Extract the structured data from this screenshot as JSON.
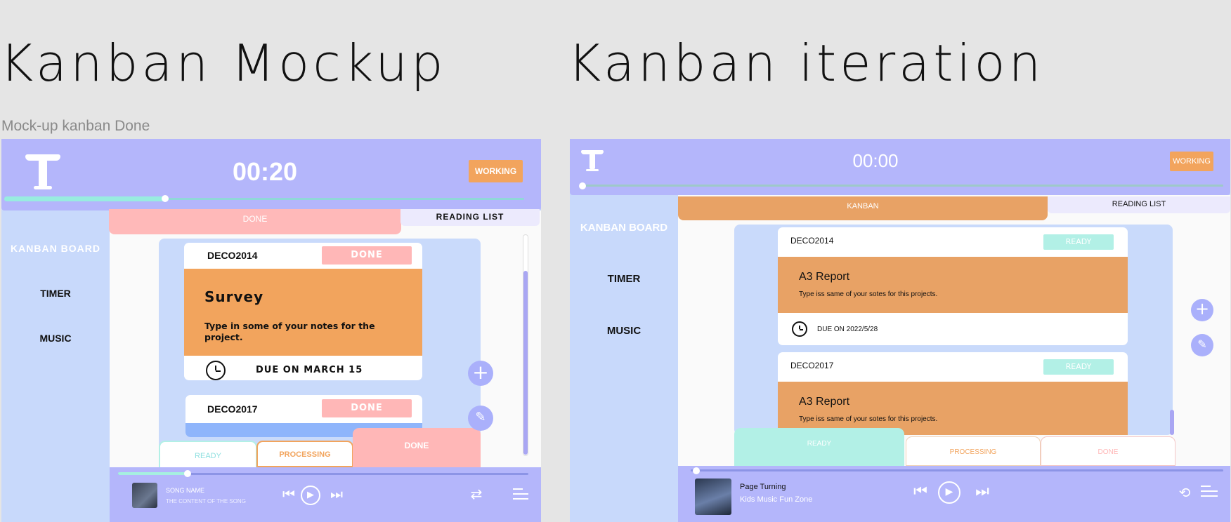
{
  "headings": {
    "left": "Kanban Mockup",
    "right": "Kanban iteration",
    "caption": "Mock-up kanban Done"
  },
  "mockup": {
    "timer": "00:20",
    "status": "WORKING",
    "timer_progress": 0.31,
    "nav": {
      "kanban": "KANBAN BOARD",
      "timer": "TIMER",
      "music": "MUSIC"
    },
    "tabs": {
      "active": "DONE",
      "other": "READING LIST"
    },
    "cards": [
      {
        "code": "DECO2014",
        "badge": "DONE",
        "title": "Survey",
        "note": "Type in some of your notes for the project.",
        "due": "DUE ON MARCH 15"
      },
      {
        "code": "DECO2017",
        "badge": "DONE"
      }
    ],
    "columns": {
      "ready": "READY",
      "processing": "PROCESSING",
      "done": "DONE"
    },
    "player": {
      "song": "SONG NAME",
      "artist": "THE CONTENT OF THE SONG",
      "progress": 0.17
    }
  },
  "iteration": {
    "timer": "00:00",
    "status": "WORKING",
    "timer_progress": 0.0,
    "nav": {
      "kanban": "KANBAN BOARD",
      "timer": "TIMER",
      "music": "MUSIC"
    },
    "tabs": {
      "active": "KANBAN",
      "other": "READING LIST"
    },
    "cards": [
      {
        "code": "DECO2014",
        "badge": "READY",
        "title": "A3 Report",
        "note": "Type iss same of your sotes for this projects.",
        "due": "DUE ON 2022/5/28"
      },
      {
        "code": "DECO2017",
        "badge": "READY",
        "title": "A3 Report",
        "note": "Type iss same of your sotes for this projects."
      }
    ],
    "columns": {
      "ready": "READY",
      "processing": "PROCESSING",
      "done": "DONE"
    },
    "player": {
      "song": "Page Turning",
      "artist": "Kids Music Fun Zone",
      "progress": 0.01
    }
  },
  "colors": {
    "lavender": "#b4b6fb",
    "sky": "#c8d9fb",
    "orange": "#f2a45d",
    "pink": "#ffb7b7",
    "teal": "#b2f0e6",
    "blue_card": "#8fb5fb"
  },
  "icons": [
    "logo-icon",
    "clock-icon",
    "plus-icon",
    "pencil-icon",
    "previous-icon",
    "play-icon",
    "next-icon",
    "shuffle-icon",
    "repeat-icon",
    "playlist-icon"
  ]
}
